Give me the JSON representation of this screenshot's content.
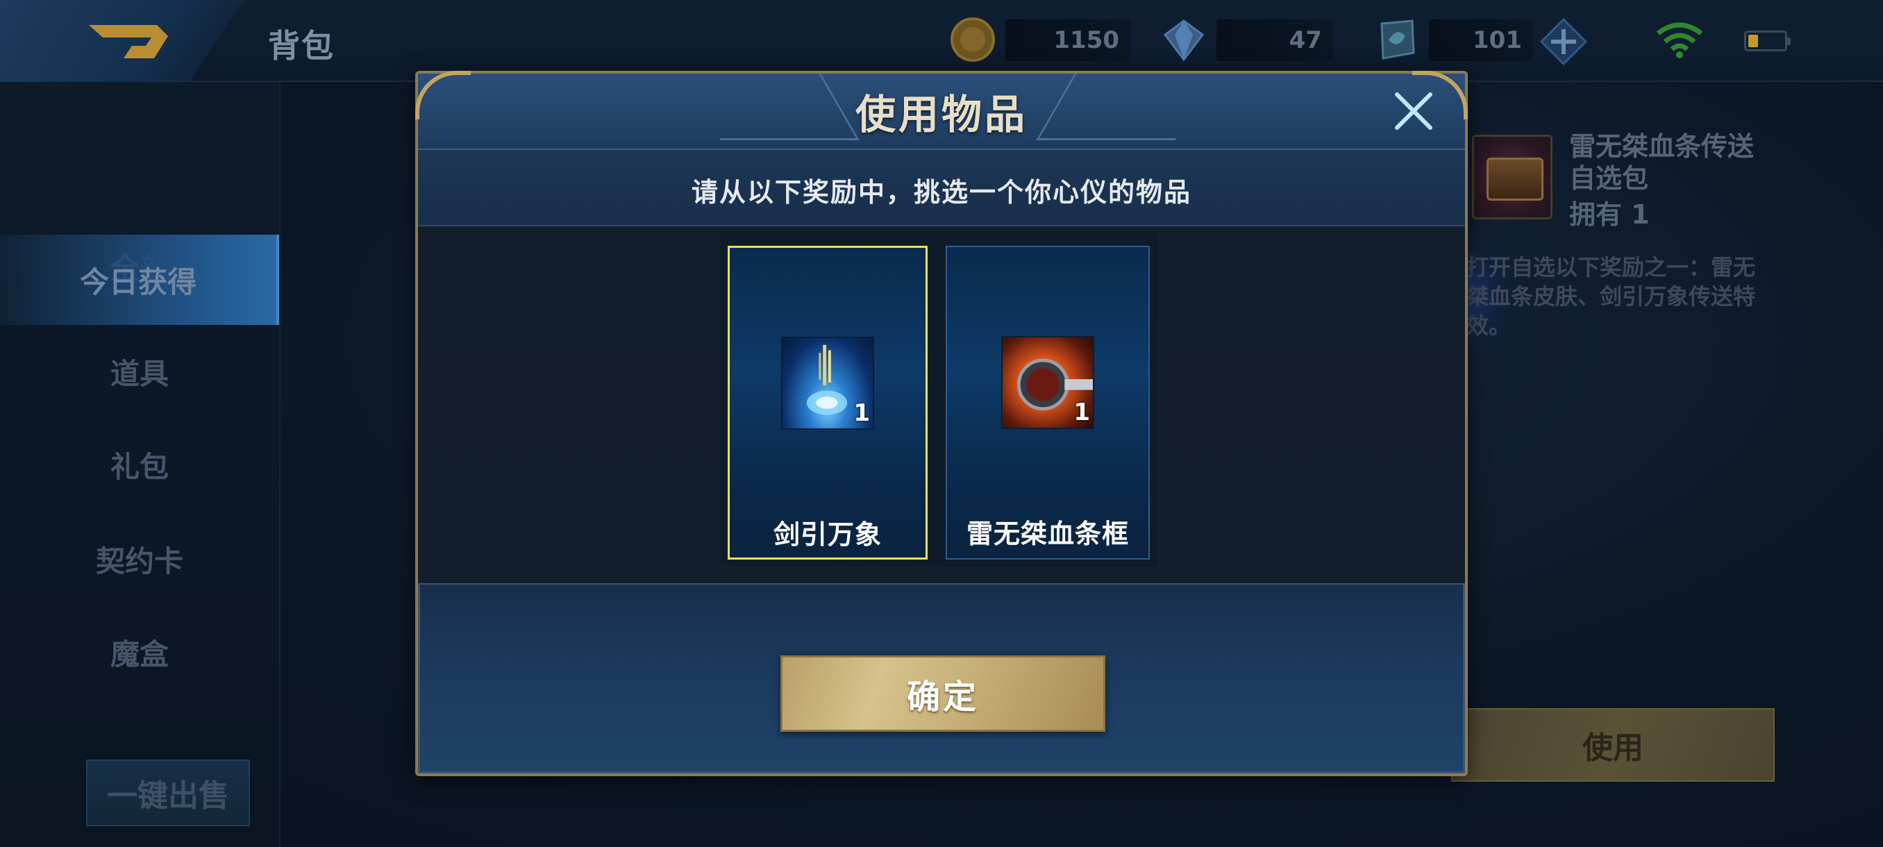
{
  "header": {
    "title": "背包",
    "currencies": [
      {
        "name": "gold-coin",
        "value": "1150"
      },
      {
        "name": "diamond",
        "value": "47"
      },
      {
        "name": "gem-token",
        "value": "101"
      }
    ]
  },
  "sidebar": {
    "items": [
      {
        "label": "全部"
      },
      {
        "label": "今日获得",
        "active": true
      },
      {
        "label": "道具"
      },
      {
        "label": "礼包"
      },
      {
        "label": "契约卡"
      },
      {
        "label": "魔盒"
      }
    ],
    "sell_label": "一键出售"
  },
  "detail": {
    "name": "雷无桀血条传送自选包",
    "own": "拥有 1",
    "description": "打开自选以下奖励之一：雷无桀血条皮肤、剑引万象传送特效。",
    "use_label": "使用"
  },
  "modal": {
    "title": "使用物品",
    "subtitle": "请从以下奖励中，挑选一个你心仪的物品",
    "items": [
      {
        "name": "剑引万象",
        "qty": "1",
        "selected": true,
        "icon": "sword-portal-icon"
      },
      {
        "name": "雷无桀血条框",
        "qty": "1",
        "selected": false,
        "icon": "health-bar-frame-icon"
      }
    ],
    "confirm_label": "确定"
  },
  "colors": {
    "accent_gold": "#c2a561",
    "selected_border": "#e7e35a",
    "confirm_button": "#c7b07a"
  }
}
